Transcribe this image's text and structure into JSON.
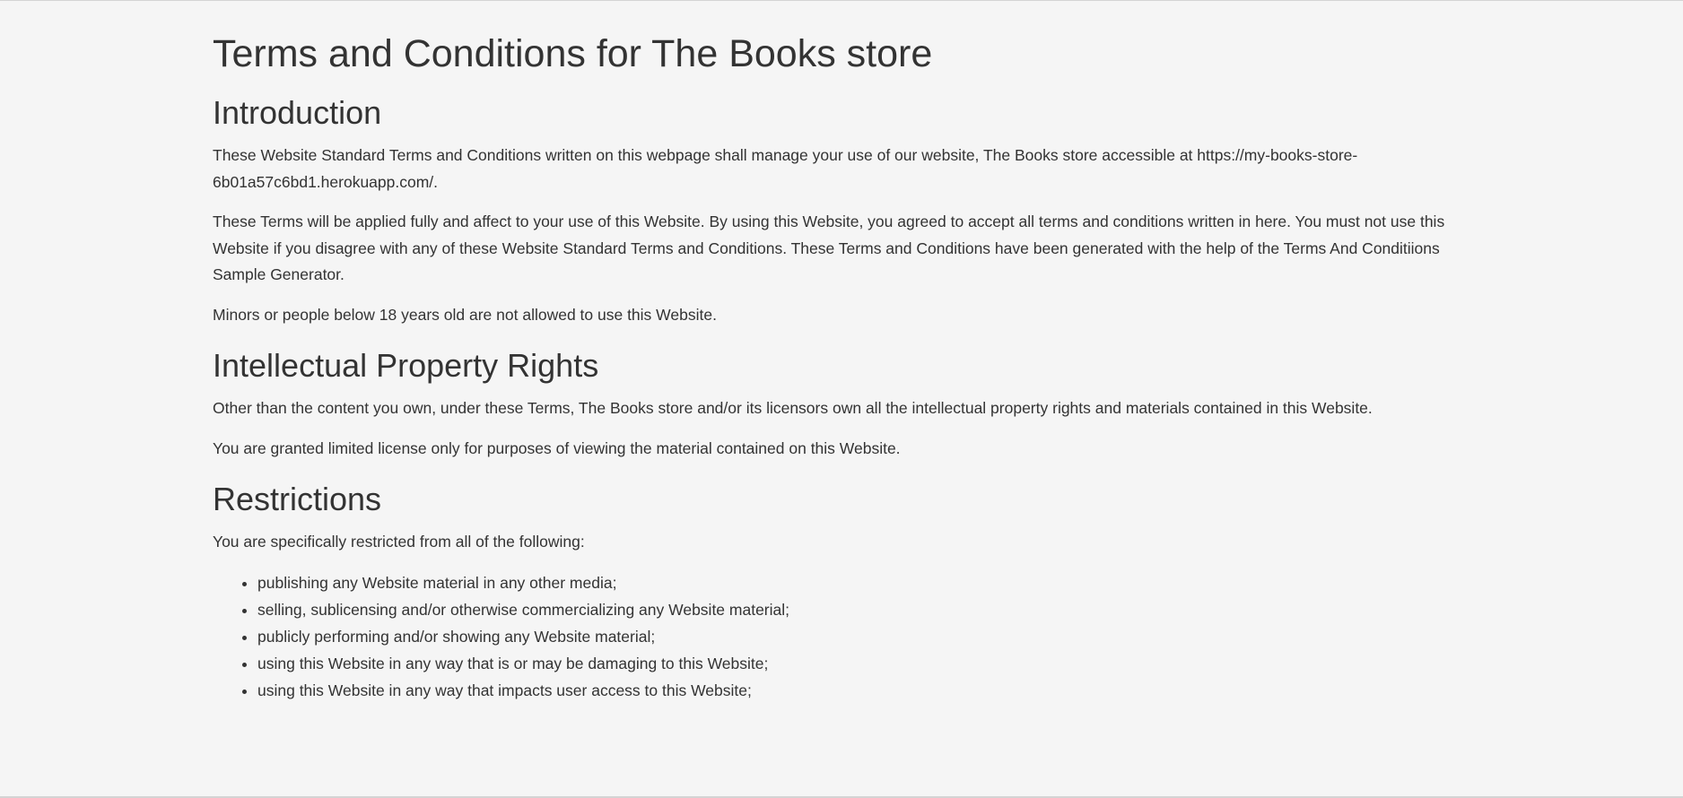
{
  "title": "Terms and Conditions for The Books store",
  "sections": [
    {
      "heading": "Introduction",
      "paragraphs": [
        "These Website Standard Terms and Conditions written on this webpage shall manage your use of our website, The Books store accessible at https://my-books-store-6b01a57c6bd1.herokuapp.com/.",
        "These Terms will be applied fully and affect to your use of this Website. By using this Website, you agreed to accept all terms and conditions written in here. You must not use this Website if you disagree with any of these Website Standard Terms and Conditions. These Terms and Conditions have been generated with the help of the Terms And Conditiions Sample Generator.",
        "Minors or people below 18 years old are not allowed to use this Website."
      ]
    },
    {
      "heading": "Intellectual Property Rights",
      "paragraphs": [
        "Other than the content you own, under these Terms, The Books store and/or its licensors own all the intellectual property rights and materials contained in this Website.",
        "You are granted limited license only for purposes of viewing the material contained on this Website."
      ]
    },
    {
      "heading": "Restrictions",
      "paragraphs": [
        "You are specifically restricted from all of the following:"
      ],
      "list": [
        "publishing any Website material in any other media;",
        "selling, sublicensing and/or otherwise commercializing any Website material;",
        "publicly performing and/or showing any Website material;",
        "using this Website in any way that is or may be damaging to this Website;",
        "using this Website in any way that impacts user access to this Website;"
      ]
    }
  ]
}
